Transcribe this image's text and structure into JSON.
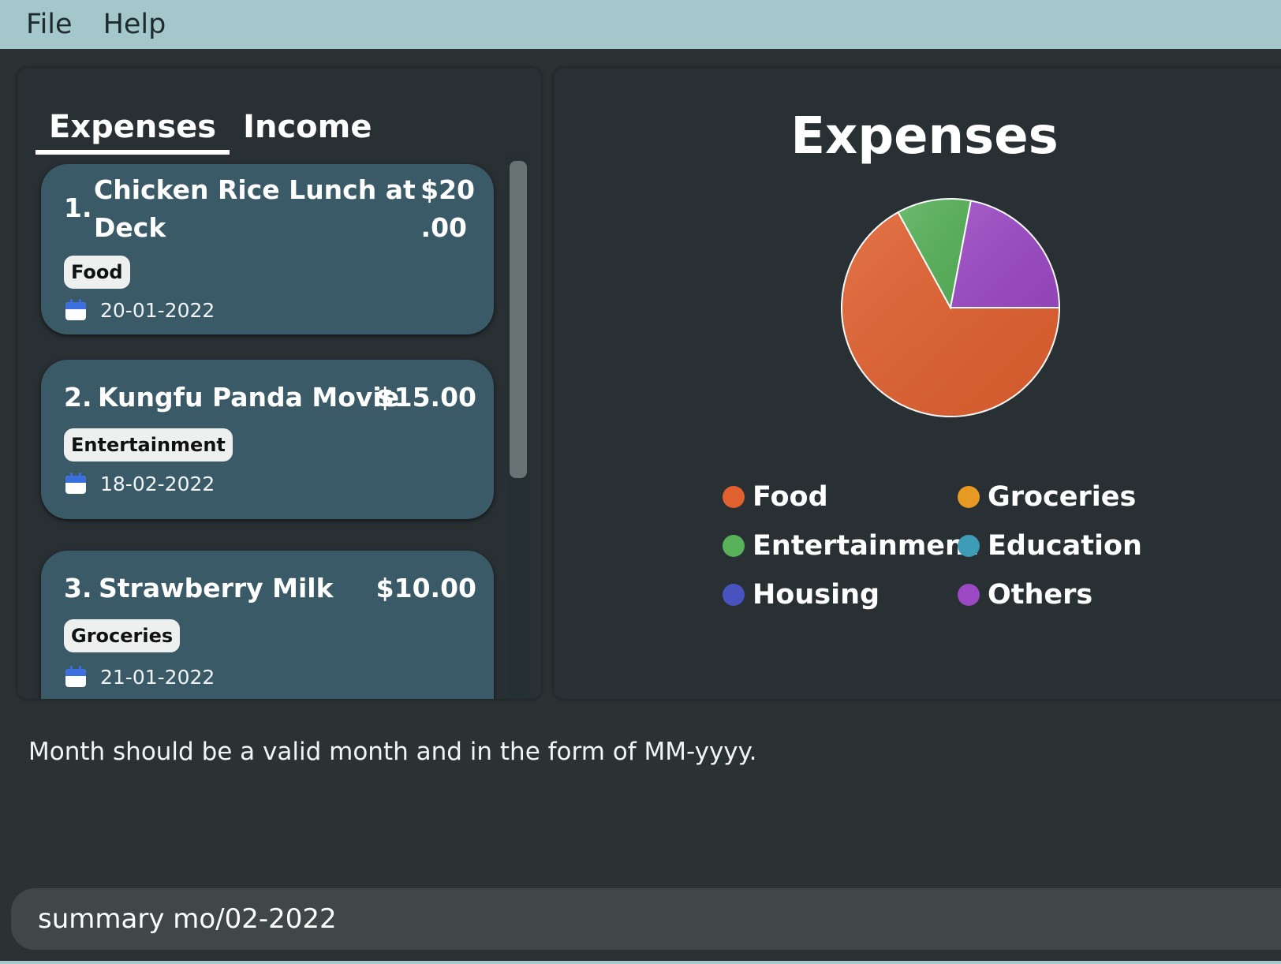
{
  "menu": {
    "file": "File",
    "help": "Help"
  },
  "tabs": [
    {
      "label": "Expenses",
      "active": true
    },
    {
      "label": "Income",
      "active": false
    }
  ],
  "expenses": [
    {
      "index": "1.",
      "title_line1": "Chicken Rice Lunch at",
      "title_line2": "Deck",
      "amount_line1": "$20",
      "amount_line2": ".00",
      "tag": "Food",
      "date": "20-01-2022"
    },
    {
      "index": "2.",
      "title": "Kungfu Panda Movie",
      "amount": "$15.00",
      "tag": "Entertainment",
      "date": "18-02-2022"
    },
    {
      "index": "3.",
      "title": "Strawberry Milk",
      "amount": "$10.00",
      "tag": "Groceries",
      "date": "21-01-2022"
    }
  ],
  "icons": {
    "date": "calendar-icon"
  },
  "chart_data": {
    "type": "pie",
    "title": "Expenses",
    "labels": [
      "Food",
      "Entertainment",
      "Others"
    ],
    "values": [
      67,
      11,
      22
    ],
    "colors": [
      "#e0602f",
      "#57b25a",
      "#9b49c3"
    ],
    "legend_position": "bottom",
    "legend": [
      {
        "name": "Food",
        "color": "#e0602f"
      },
      {
        "name": "Groceries",
        "color": "#e69a24"
      },
      {
        "name": "Entertainment",
        "color": "#57b25a"
      },
      {
        "name": "Education",
        "color": "#3e9cb7"
      },
      {
        "name": "Housing",
        "color": "#4953bf"
      },
      {
        "name": "Others",
        "color": "#9b49c3"
      }
    ]
  },
  "result_message": "Month should be a valid month and in the form of MM-yyyy.",
  "command_input": {
    "value": "summary mo/02-2022"
  }
}
